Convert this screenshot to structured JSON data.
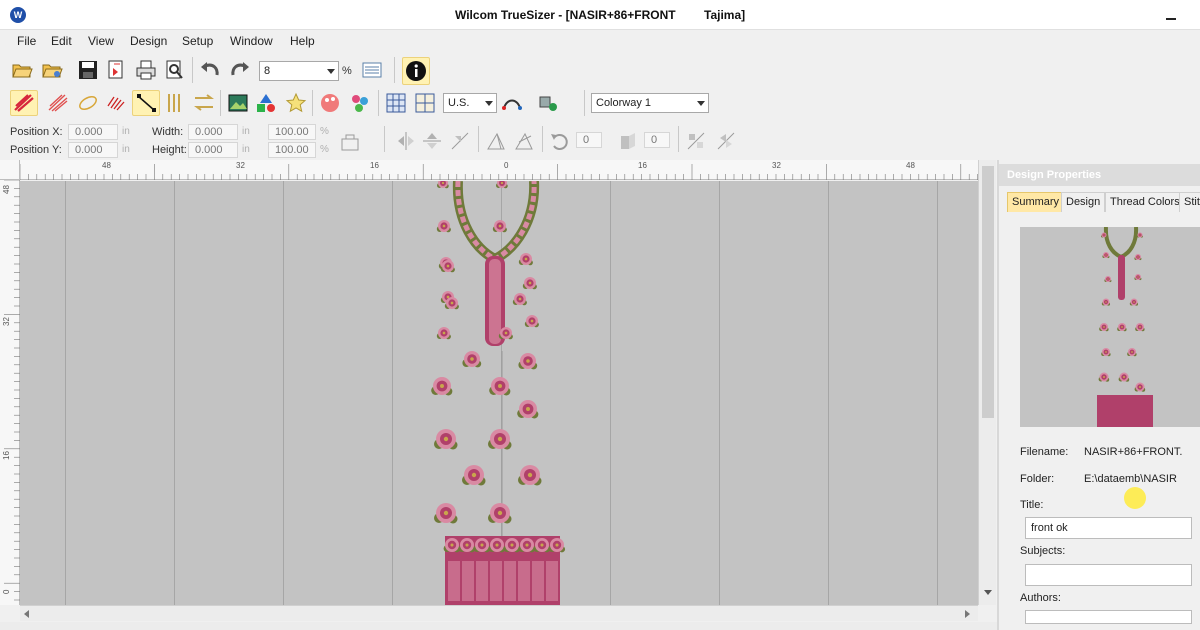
{
  "window": {
    "title": "Wilcom TrueSizer - [NASIR+86+FRONT",
    "machine_format": "Tajima]"
  },
  "menu": [
    "File",
    "Edit",
    "View",
    "Design",
    "Setup",
    "Window",
    "Help"
  ],
  "toolbar1": {
    "zoom_value": "8",
    "zoom_unit": "%",
    "icons": [
      "open-folder-icon",
      "open-special-icon",
      "save-icon",
      "export-icon",
      "print-icon",
      "print-preview-icon",
      "undo-icon",
      "redo-icon",
      "measure-icon",
      "info-icon"
    ]
  },
  "toolbar2": {
    "units_value": "U.S.",
    "colorway_value": "Colorway 1",
    "icons": [
      "stitch-red-icon",
      "stitch-fill-icon",
      "outline-icon",
      "satin-icon",
      "reshape-icon",
      "split-icon",
      "convert-icon",
      "picture-icon",
      "shapes-icon",
      "star-icon",
      "color-palette-icon",
      "thread-icon",
      "grid-icon",
      "grid-alt-icon",
      "route-icon",
      "hoop-icon"
    ]
  },
  "position": {
    "x_label": "Position X:",
    "x_value": "0.000",
    "y_label": "Position Y:",
    "y_value": "0.000",
    "unit": "in"
  },
  "size": {
    "width_label": "Width:",
    "width_value": "0.000",
    "height_label": "Height:",
    "height_value": "0.000",
    "unit": "in",
    "scale_x": "100.00",
    "scale_y": "100.00",
    "pct": "%"
  },
  "rotate_value": "0",
  "slant_value": "0",
  "ruler": {
    "h_labels": [
      "48",
      "32",
      "16",
      "0",
      "16",
      "32",
      "48"
    ],
    "v_labels": [
      "48",
      "32",
      "16",
      "0"
    ]
  },
  "panel": {
    "header": "Design Properties",
    "tabs": [
      "Summary",
      "Design",
      "Thread Colors",
      "Stit"
    ],
    "filename_label": "Filename:",
    "filename_value": "NASIR+86+FRONT.",
    "folder_label": "Folder:",
    "folder_value": "E:\\dataemb\\NASIR",
    "title_label": "Title:",
    "title_value": "front ok",
    "subjects_label": "Subjects:",
    "subjects_value": "",
    "authors_label": "Authors:"
  },
  "colors": {
    "canvas": "#c3c3c3",
    "thread_primary": "#b0406a",
    "thread_secondary": "#d98aa3",
    "leaf": "#6f7a3a",
    "gold": "#c9a64c",
    "highlight_tab": "#ffe8a6"
  }
}
